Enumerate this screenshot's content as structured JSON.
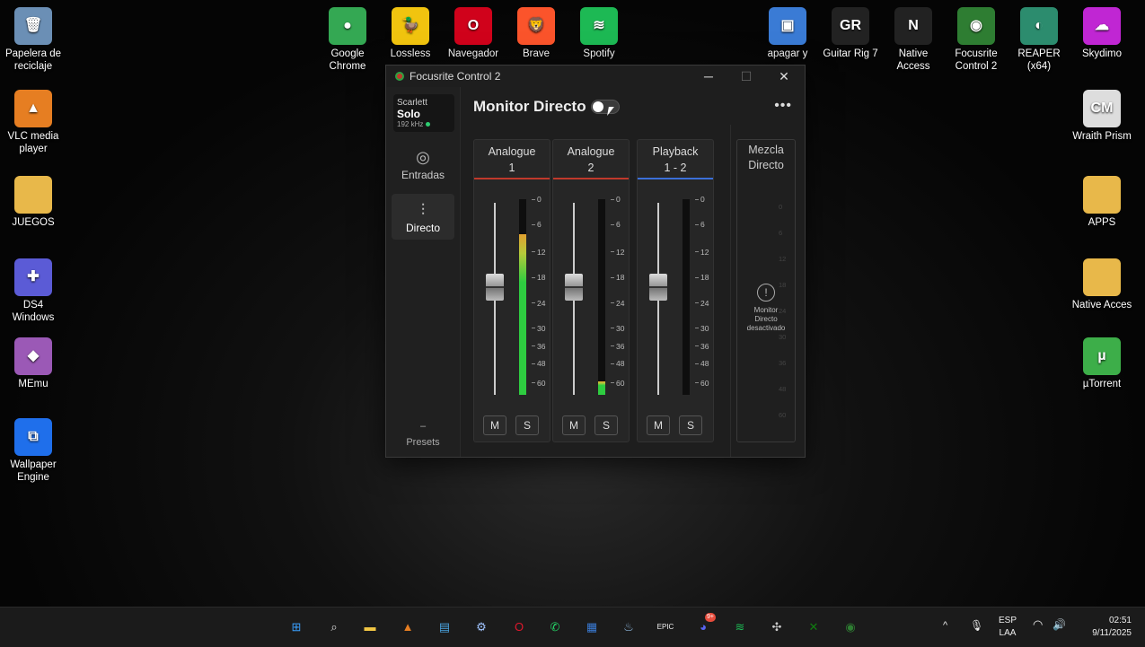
{
  "desktop_icons": [
    {
      "label": "Papelera de reciclaje",
      "icon": "recycle-bin-icon",
      "color": "#6b8fb5",
      "glyph": "🗑"
    },
    {
      "label": "VLC media player",
      "icon": "vlc-icon",
      "color": "#e67e22",
      "glyph": "▲"
    },
    {
      "label": "JUEGOS",
      "icon": "folder-icon",
      "color": "#e8b84a",
      "glyph": ""
    },
    {
      "label": "DS4 Windows",
      "icon": "gamepad-icon",
      "color": "#5b5bd6",
      "glyph": "✚"
    },
    {
      "label": "MEmu",
      "icon": "memu-icon",
      "color": "#9b59b6",
      "glyph": "◆"
    },
    {
      "label": "Wallpaper Engine",
      "icon": "wallpaper-engine-icon",
      "color": "#1f6feb",
      "glyph": "⧉"
    },
    {
      "label": "Google Chrome",
      "icon": "chrome-icon",
      "color": "#34a853",
      "glyph": "●"
    },
    {
      "label": "Lossless",
      "icon": "lossless-icon",
      "color": "#f1c40f",
      "glyph": "🦆"
    },
    {
      "label": "Navegador",
      "icon": "opera-icon",
      "color": "#d0021b",
      "glyph": "O"
    },
    {
      "label": "Brave",
      "icon": "brave-icon",
      "color": "#fb542b",
      "glyph": "🦁"
    },
    {
      "label": "Spotify",
      "icon": "spotify-icon",
      "color": "#1db954",
      "glyph": "≋"
    },
    {
      "label": "apagar y",
      "icon": "shutdown-shortcut-icon",
      "color": "#3a7bd5",
      "glyph": "▣"
    },
    {
      "label": "Guitar Rig 7",
      "icon": "guitar-rig-icon",
      "color": "#222222",
      "glyph": "GR"
    },
    {
      "label": "Native Access",
      "icon": "native-access-icon",
      "color": "#222222",
      "glyph": "N"
    },
    {
      "label": "Focusrite Control 2",
      "icon": "focusrite-icon",
      "color": "#2e7d32",
      "glyph": "◉"
    },
    {
      "label": "REAPER (x64)",
      "icon": "reaper-icon",
      "color": "#2c8c6e",
      "glyph": "◐"
    },
    {
      "label": "Skydimo",
      "icon": "skydimo-icon",
      "color": "#c026d3",
      "glyph": "☁"
    },
    {
      "label": "Wraith Prism",
      "icon": "cooler-master-icon",
      "color": "#dddddd",
      "glyph": "CM"
    },
    {
      "label": "APPS",
      "icon": "apps-folder-icon",
      "color": "#e8b84a",
      "glyph": ""
    },
    {
      "label": "Native Acces",
      "icon": "native-folder-icon",
      "color": "#e8b84a",
      "glyph": ""
    },
    {
      "label": "µTorrent",
      "icon": "utorrent-icon",
      "color": "#3dae49",
      "glyph": "µ"
    }
  ],
  "window": {
    "title": "Focusrite Control 2",
    "minimize": "─",
    "maximize": "☐",
    "close": "✕"
  },
  "sidebar": {
    "device_line1": "Scarlett",
    "device_line2": "Solo",
    "sample_rate": "192 kHz",
    "nav": [
      {
        "label": "Entradas",
        "icon": "inputs-icon",
        "glyph": "◎"
      },
      {
        "label": "Directo",
        "icon": "mixer-sliders-icon",
        "glyph": "⫶"
      }
    ],
    "presets_dash": "–",
    "presets_label": "Presets"
  },
  "monitor": {
    "title": "Monitor Directo",
    "enabled": false,
    "more": "•••"
  },
  "channels": [
    {
      "name": "Analogue\n1",
      "line_color": "#c0392b",
      "fader_level": 0.75,
      "meter_level": 0.82,
      "mute": "M",
      "solo": "S"
    },
    {
      "name": "Analogue\n2",
      "line_color": "#c0392b",
      "fader_level": 0.75,
      "meter_level": 0.07,
      "mute": "M",
      "solo": "S"
    },
    {
      "name": "Playback\n1 - 2",
      "line_color": "#3b6fd8",
      "fader_level": 0.75,
      "meter_level": 0.0,
      "mute": "M",
      "solo": "S"
    }
  ],
  "meter_scale": [
    "0",
    "6",
    "12",
    "18",
    "24",
    "30",
    "36",
    "48",
    "60"
  ],
  "direct_mix": {
    "name": "Mezcla\nDirecto",
    "warning_glyph": "!",
    "warning_text": "Monitor\nDirecto\ndesactivado",
    "ghost_scale": [
      "0",
      "6",
      "12",
      "18",
      "24",
      "30",
      "36",
      "48",
      "60"
    ]
  },
  "taskbar": {
    "apps": [
      {
        "icon": "windows-start-icon",
        "glyph": "⊞",
        "color": "#3aa0ff"
      },
      {
        "icon": "search-icon",
        "glyph": "⌕",
        "color": "#dddddd"
      },
      {
        "icon": "file-explorer-icon",
        "glyph": "▬",
        "color": "#f2c744"
      },
      {
        "icon": "vlc-taskbar-icon",
        "glyph": "▲",
        "color": "#e67e22"
      },
      {
        "icon": "window-app-icon",
        "glyph": "▤",
        "color": "#4aa3df"
      },
      {
        "icon": "settings-icon",
        "glyph": "⚙",
        "color": "#a0c4ff"
      },
      {
        "icon": "opera-taskbar-icon",
        "glyph": "O",
        "color": "#e0182d"
      },
      {
        "icon": "whatsapp-icon",
        "glyph": "✆",
        "color": "#25d366"
      },
      {
        "icon": "store-icon",
        "glyph": "▦",
        "color": "#3a7bd5"
      },
      {
        "icon": "steam-icon",
        "glyph": "♨",
        "color": "#8fb8de"
      },
      {
        "icon": "epic-games-icon",
        "glyph": "EPIC",
        "color": "#eeeeee"
      },
      {
        "icon": "discord-icon",
        "glyph": "◕",
        "color": "#5865f2"
      },
      {
        "icon": "spotify-taskbar-icon",
        "glyph": "≋",
        "color": "#1db954"
      },
      {
        "icon": "app-badge-icon",
        "glyph": "✣",
        "color": "#cccccc"
      },
      {
        "icon": "xbox-icon",
        "glyph": "✕",
        "color": "#107c10"
      },
      {
        "icon": "focusrite-taskbar-icon",
        "glyph": "◉",
        "color": "#2e7d32"
      }
    ],
    "discord_badge": "9+",
    "lang_line1": "ESP",
    "lang_line2": "LAA",
    "time": "02:51",
    "date": "9/11/2025",
    "chevron": "^",
    "mic": "🎙",
    "wifi": "◠",
    "volume": "🔊"
  }
}
